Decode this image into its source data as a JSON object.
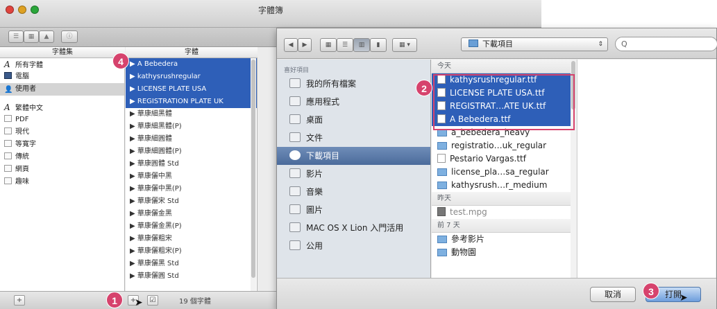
{
  "font_book": {
    "title": "字體簿",
    "collections_header": "字體集",
    "fonts_header": "字體",
    "collections": [
      {
        "icon": "font-icon",
        "label": "所有字體"
      },
      {
        "icon": "computer-icon",
        "label": "電腦"
      },
      {
        "icon": "user-icon",
        "label": "使用者"
      },
      {
        "icon": "font-icon",
        "label": "繁體中文"
      },
      {
        "icon": "collection-icon",
        "label": "PDF"
      },
      {
        "icon": "collection-icon",
        "label": "現代"
      },
      {
        "icon": "collection-icon",
        "label": "等寬字"
      },
      {
        "icon": "collection-icon",
        "label": "傳統"
      },
      {
        "icon": "collection-icon",
        "label": "網頁"
      },
      {
        "icon": "collection-icon",
        "label": "趣味"
      }
    ],
    "fonts": [
      "▶ A Bebedera",
      "▶ kathysrushregular",
      "▶ LICENSE PLATE USA",
      "▶ REGISTRATION PLATE UK",
      "▶ 華康細黑體",
      "▶ 華康細黑體(P)",
      "▶ 華康細圓體",
      "▶ 華康細圓體(P)",
      "▶ 華康圓體 Std",
      "▶ 華康儷中黑",
      "▶ 華康儷中黑(P)",
      "▶ 華康儷宋 Std",
      "▶ 華康儷金黑",
      "▶ 華康儷金黑(P)",
      "▶ 華康儷粗宋",
      "▶ 華康儷粗宋(P)",
      "▶ 華康儷黑 Std",
      "▶ 華康儷圓 Std"
    ],
    "add_button": "+",
    "font_count": "19 個字體"
  },
  "open_dialog": {
    "location": "下載項目",
    "search_placeholder": "Q",
    "favorites_header": "喜好項目",
    "sidebar": [
      {
        "icon": "all-files-icon",
        "label": "我的所有檔案"
      },
      {
        "icon": "applications-icon",
        "label": "應用程式"
      },
      {
        "icon": "desktop-icon",
        "label": "桌面"
      },
      {
        "icon": "documents-icon",
        "label": "文件"
      },
      {
        "icon": "downloads-icon",
        "label": "下載項目"
      },
      {
        "icon": "movies-icon",
        "label": "影片"
      },
      {
        "icon": "music-icon",
        "label": "音樂"
      },
      {
        "icon": "pictures-icon",
        "label": "圖片"
      },
      {
        "icon": "folder-icon",
        "label": "MAC OS X Lion 入門活用"
      },
      {
        "icon": "folder-icon",
        "label": "公用"
      }
    ],
    "sections": [
      {
        "header": "今天",
        "files": [
          {
            "icon": "font-file-icon",
            "name": "kathysrushregular.ttf"
          },
          {
            "icon": "font-file-icon",
            "name": "LICENSE PLATE USA.ttf"
          },
          {
            "icon": "font-file-icon",
            "name": "REGISTRAT…ATE UK.ttf"
          },
          {
            "icon": "font-file-icon",
            "name": "A Bebedera.ttf"
          },
          {
            "icon": "folder-icon",
            "name": "a_bebedera_heavy"
          },
          {
            "icon": "folder-icon",
            "name": "registratio…uk_regular"
          },
          {
            "icon": "font-file-icon",
            "name": "Pestario Vargas.ttf"
          },
          {
            "icon": "folder-icon",
            "name": "license_pla…sa_regular"
          },
          {
            "icon": "folder-icon",
            "name": "kathysrush…r_medium"
          }
        ]
      },
      {
        "header": "昨天",
        "files": [
          {
            "icon": "movie-file-icon",
            "name": "test.mpg"
          }
        ]
      },
      {
        "header": "前 7 天",
        "files": [
          {
            "icon": "folder-icon",
            "name": "參考影片"
          },
          {
            "icon": "folder-icon",
            "name": "動物園"
          }
        ]
      }
    ],
    "cancel_label": "取消",
    "open_label": "打開"
  },
  "badges": [
    "1",
    "2",
    "3",
    "4"
  ],
  "colors": {
    "selection": "#2e5fb8",
    "badge": "#d6436d"
  }
}
